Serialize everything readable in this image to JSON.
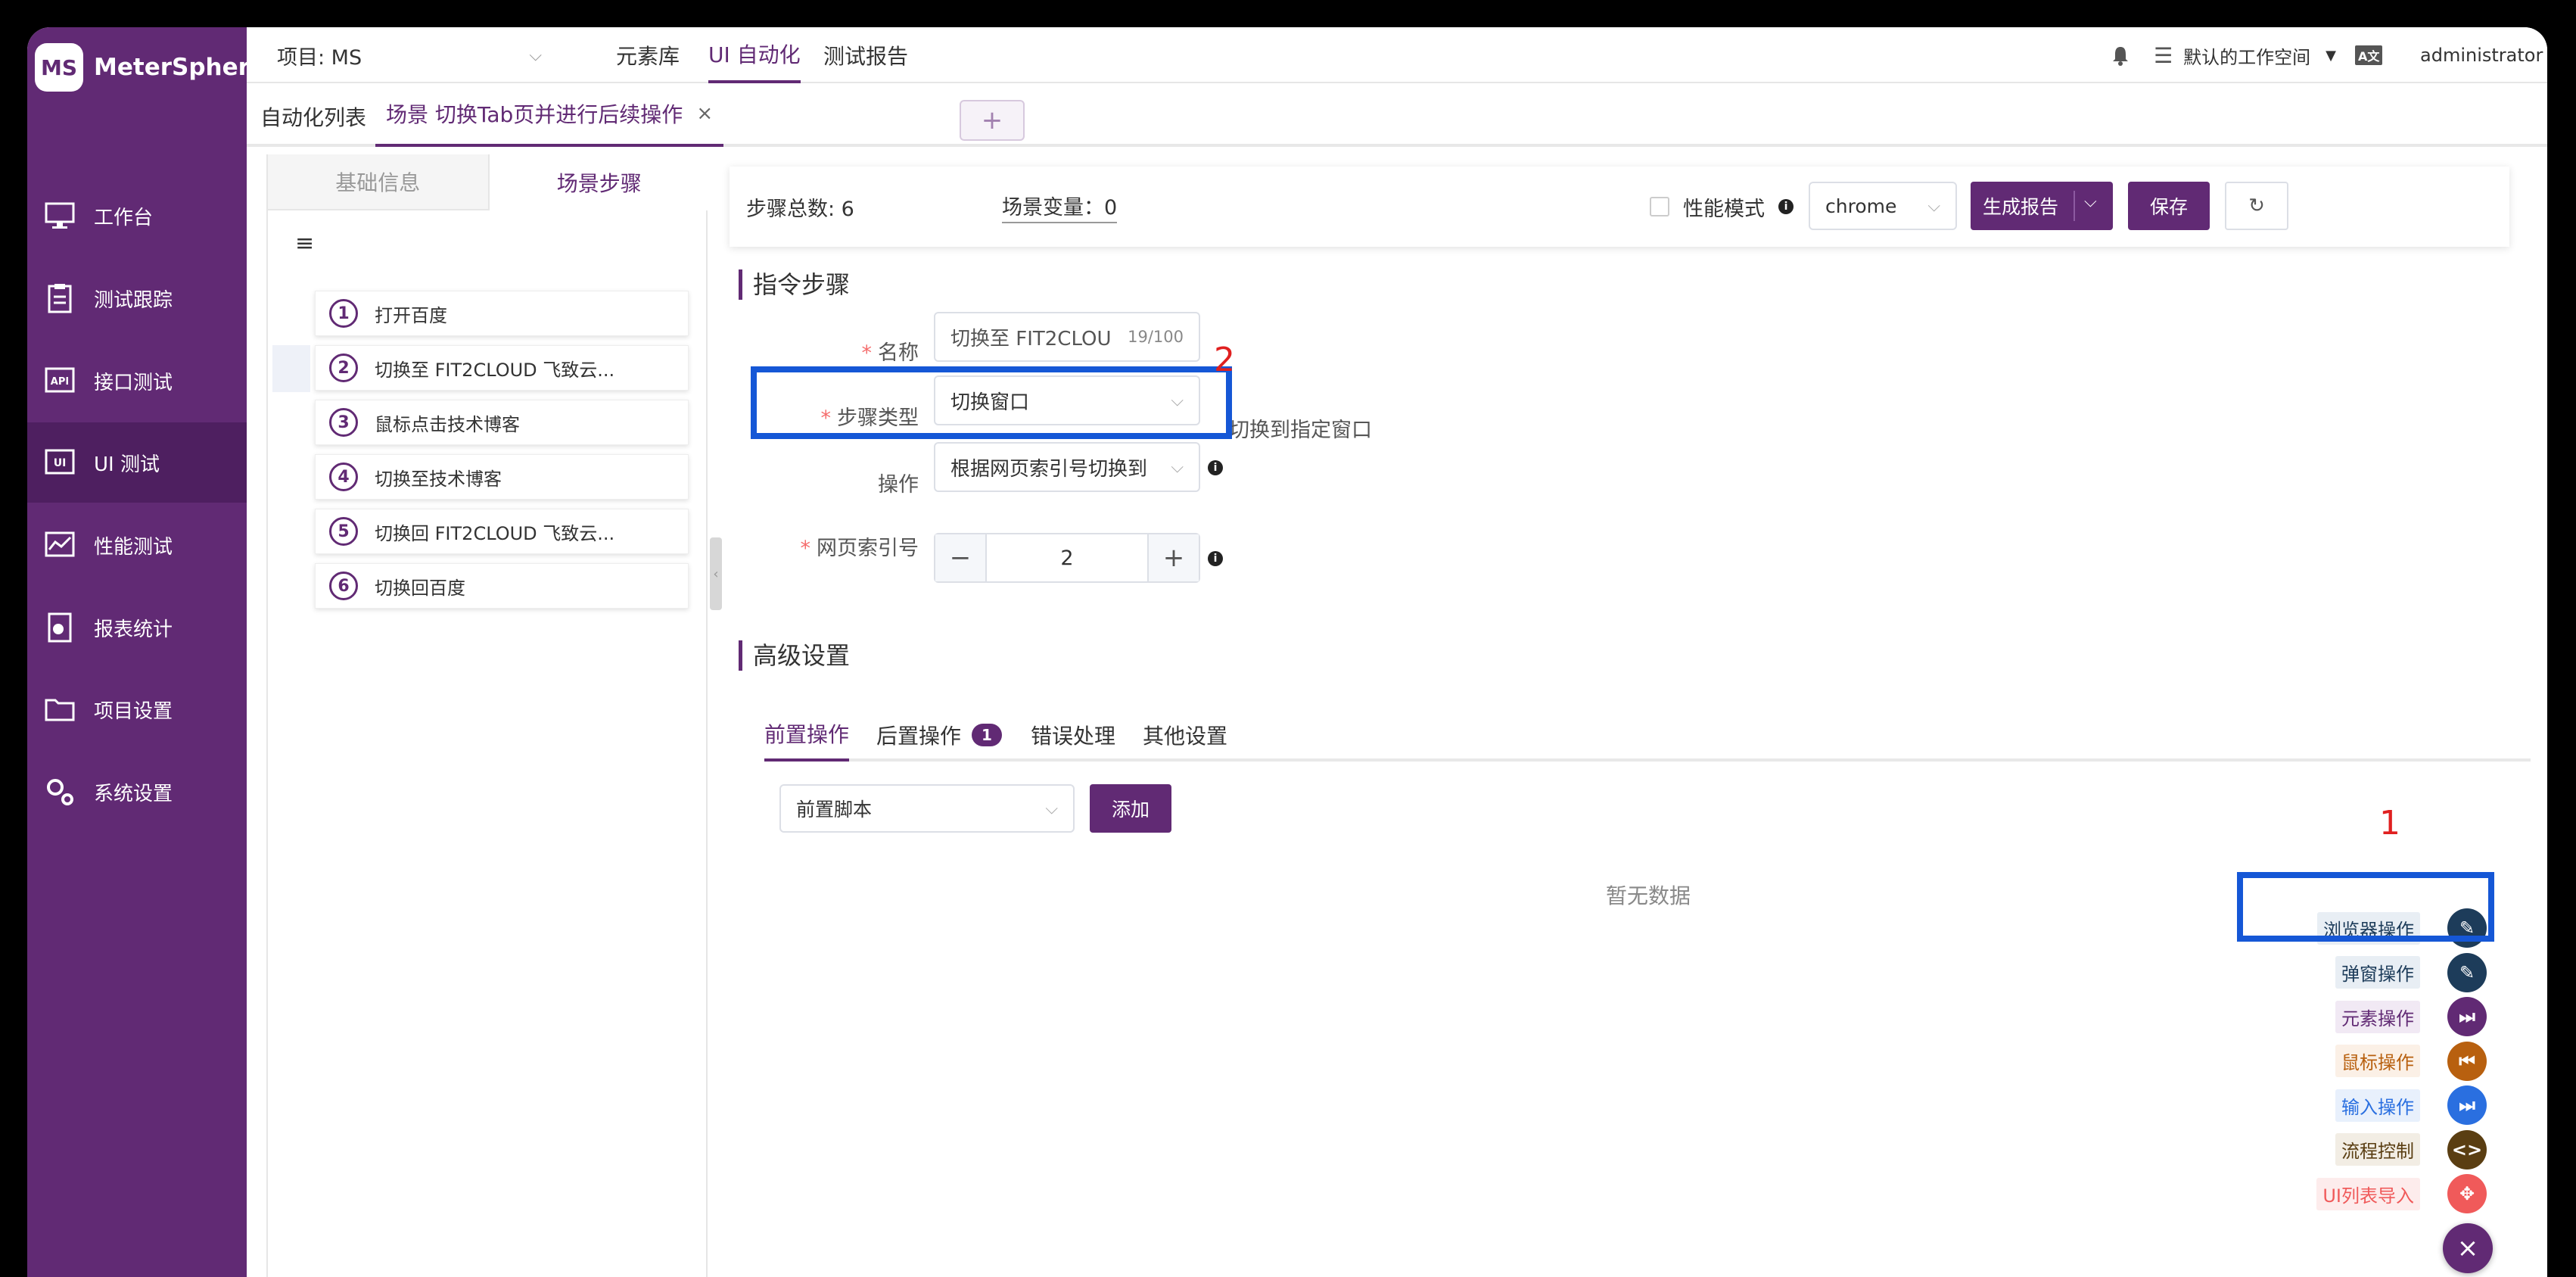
{
  "app": {
    "name": "MeterSphere",
    "logo_mark": "MS"
  },
  "sidebar": {
    "items": [
      {
        "label": "工作台",
        "icon": "monitor-icon"
      },
      {
        "label": "测试跟踪",
        "icon": "clipboard-icon"
      },
      {
        "label": "接口测试",
        "icon": "api-icon"
      },
      {
        "label": "UI 测试",
        "icon": "ui-icon",
        "active": true
      },
      {
        "label": "性能测试",
        "icon": "chart-icon"
      },
      {
        "label": "报表统计",
        "icon": "report-icon"
      },
      {
        "label": "项目设置",
        "icon": "folder-icon"
      },
      {
        "label": "系统设置",
        "icon": "gear-icon"
      }
    ]
  },
  "topbar": {
    "project": "项目: MS",
    "menu": [
      "元素库",
      "UI 自动化",
      "测试报告"
    ],
    "active_menu": "UI 自动化",
    "workspace": "默认的工作空间",
    "user": "administrator"
  },
  "tabs": {
    "list_label": "自动化列表",
    "scene_label": "场景 切换Tab页并进行后续操作",
    "close_glyph": "×",
    "add_glyph": "+"
  },
  "left_panel": {
    "tabs": [
      "基础信息",
      "场景步骤"
    ],
    "active_tab": "场景步骤",
    "toggle_glyph": "≡",
    "steps": [
      {
        "num": "1",
        "label": "打开百度"
      },
      {
        "num": "2",
        "label": "切换至 FIT2CLOUD 飞致云..."
      },
      {
        "num": "3",
        "label": "鼠标点击技术博客"
      },
      {
        "num": "4",
        "label": "切换至技术博客"
      },
      {
        "num": "5",
        "label": "切换回 FIT2CLOUD 飞致云..."
      },
      {
        "num": "6",
        "label": "切换回百度"
      }
    ]
  },
  "toolbar": {
    "step_total": "步骤总数: 6",
    "scene_var": "场景变量：0",
    "perf_mode": "性能模式",
    "browser": "chrome",
    "report_btn": "生成报告",
    "save_btn": "保存",
    "refresh_glyph": "↻"
  },
  "instruction": {
    "title": "指令步骤",
    "name_label": "名称",
    "name_value": "切换至 FIT2CLOU",
    "name_count": "19/100",
    "type_label": "步骤类型",
    "type_value": "切换窗口",
    "type_hint": "切换到指定窗口",
    "op_label": "操作",
    "op_value": "根据网页索引号切换到",
    "index_label": "网页索引号",
    "index_value": "2",
    "minus": "−",
    "plus": "+"
  },
  "advanced": {
    "title": "高级设置",
    "tabs": [
      "前置操作",
      "后置操作",
      "错误处理",
      "其他设置"
    ],
    "post_badge": "1",
    "script_select": "前置脚本",
    "add_btn": "添加",
    "empty": "暂无数据"
  },
  "annotations": {
    "marker_1": "1",
    "marker_2": "2"
  },
  "fab_menu": [
    {
      "label": "浏览器操作",
      "color": "#1d3c5a",
      "label_bg": "#e8eef4",
      "label_color": "#1d3c5a",
      "icon": "pencil-icon",
      "glyph": "✎"
    },
    {
      "label": "弹窗操作",
      "color": "#1d3c5a",
      "label_bg": "#e8eef4",
      "label_color": "#1d3c5a",
      "icon": "pencil-icon",
      "glyph": "✎"
    },
    {
      "label": "元素操作",
      "color": "#612a74",
      "label_bg": "#f1e9f4",
      "label_color": "#612a74",
      "icon": "step-forward-icon",
      "glyph": "⏭"
    },
    {
      "label": "鼠标操作",
      "color": "#b8600f",
      "label_bg": "#fbf0e6",
      "label_color": "#b8600f",
      "icon": "step-back-icon",
      "glyph": "⏮"
    },
    {
      "label": "输入操作",
      "color": "#2a6fe0",
      "label_bg": "#e8f0fc",
      "label_color": "#2a6fe0",
      "icon": "step-forward-icon",
      "glyph": "⏭"
    },
    {
      "label": "流程控制",
      "color": "#5a3e12",
      "label_bg": "#f2ede4",
      "label_color": "#5a3e12",
      "icon": "code-icon",
      "glyph": "<>"
    },
    {
      "label": "UI列表导入",
      "color": "#f05a5a",
      "label_bg": "#fdecec",
      "label_color": "#f05a5a",
      "icon": "move-icon",
      "glyph": "✥"
    }
  ],
  "fab_close_glyph": "×"
}
